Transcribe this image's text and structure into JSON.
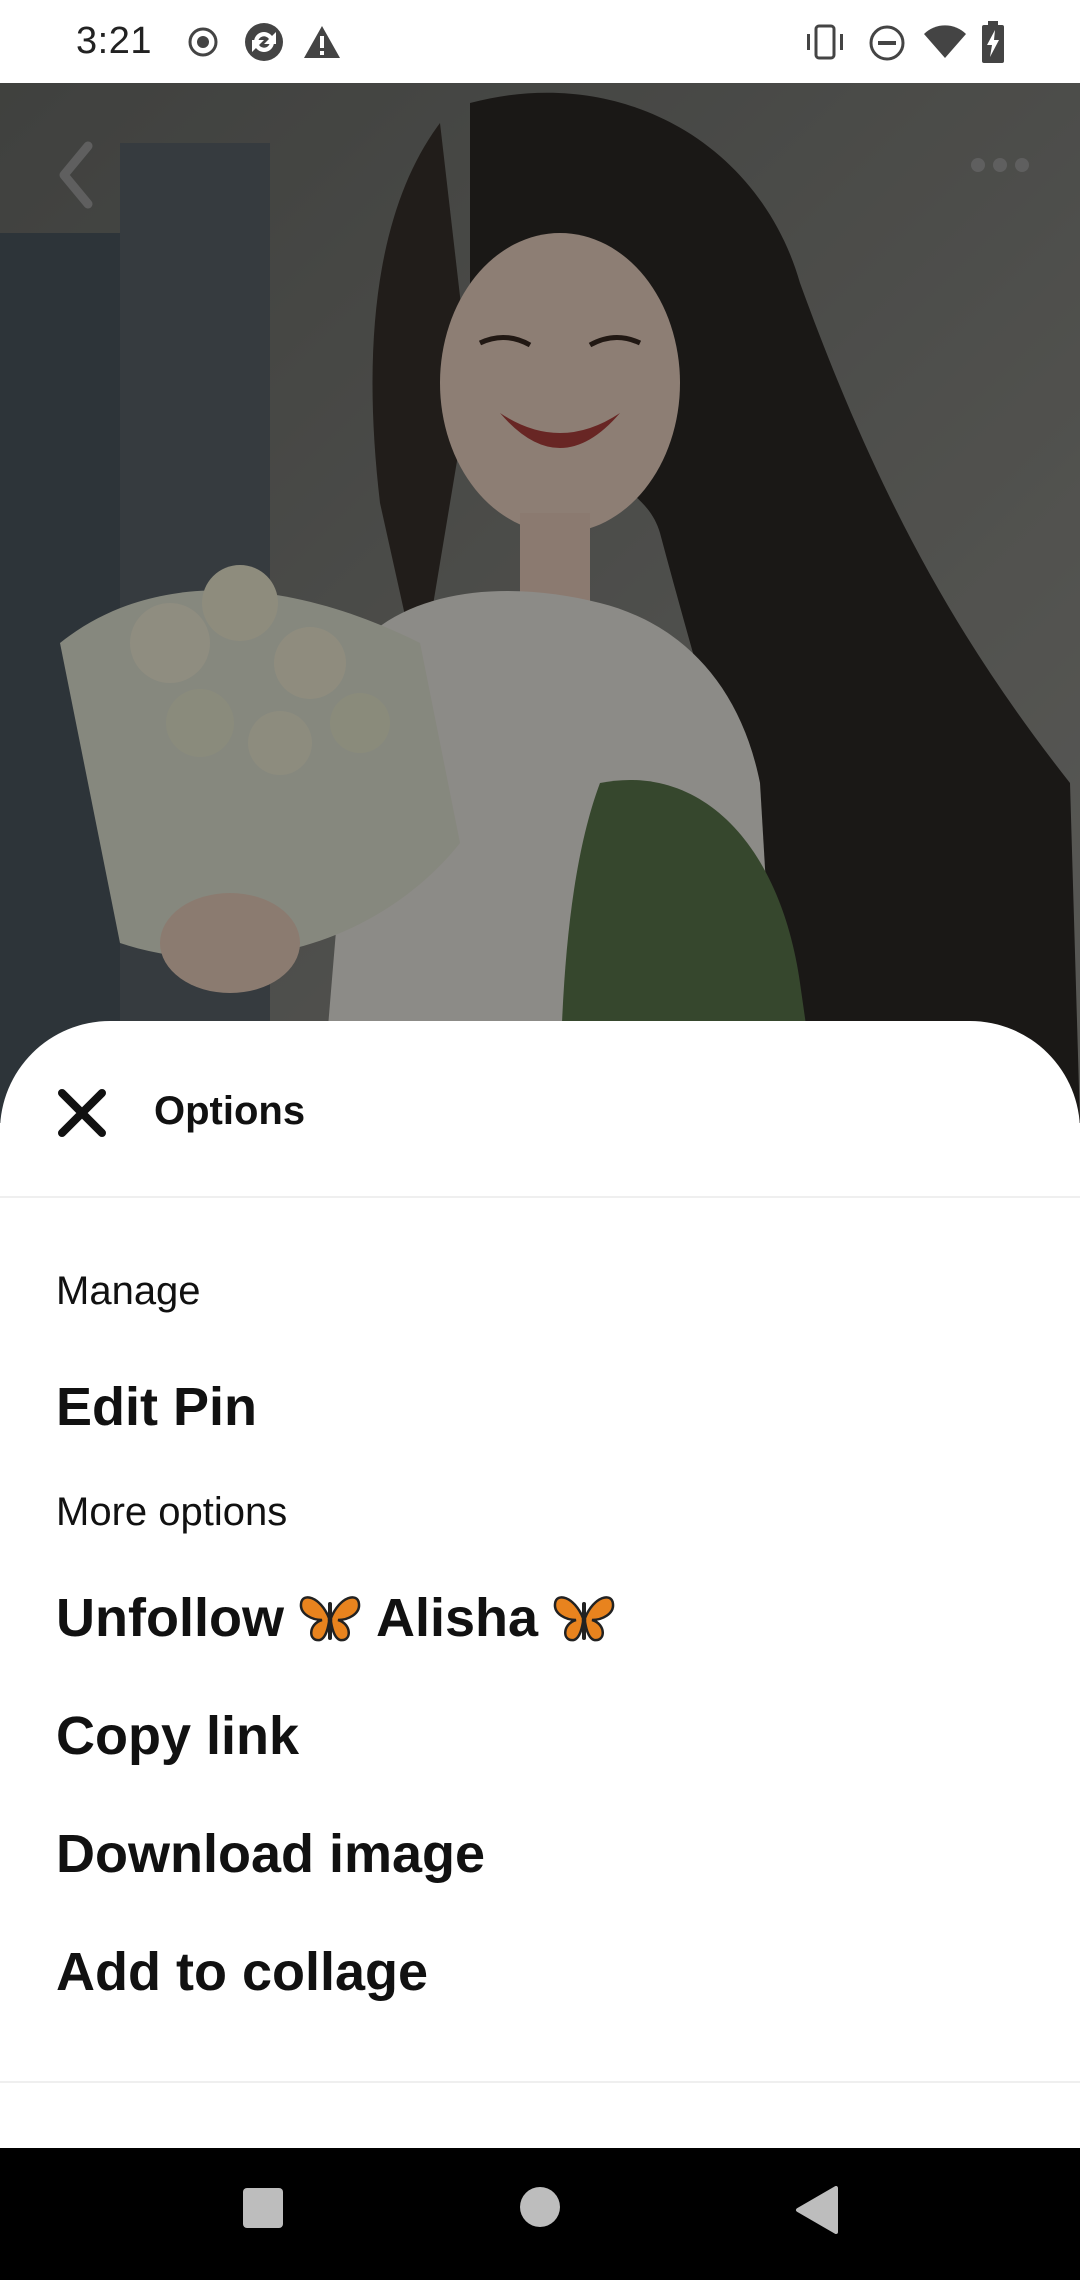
{
  "status_bar": {
    "time": "3:21",
    "left_icons": [
      "record-icon",
      "sync-icon",
      "warning-icon"
    ],
    "right_icons": [
      "vibrate-icon",
      "do-not-disturb-icon",
      "wifi-icon",
      "battery-charging-icon"
    ]
  },
  "pin_view": {
    "image_description_icon": "anime-girl-bouquet-image",
    "top_left_icon": "back-chevron-icon",
    "top_right_icon": "more-options-icon"
  },
  "sheet": {
    "title": "Options",
    "close_icon": "close-icon",
    "sections": [
      {
        "label": "Manage",
        "items": [
          "Edit Pin"
        ]
      },
      {
        "label": "More options",
        "items": [
          "Unfollow 🦋 Alisha 🦋",
          "Copy link",
          "Download image",
          "Add to collage"
        ]
      }
    ],
    "unfollow": {
      "prefix": "Unfollow",
      "name": "Alisha"
    }
  },
  "nav_bar": {
    "buttons": [
      "recents-button",
      "home-button",
      "back-button"
    ]
  },
  "colors": {
    "sheet_bg": "#ffffff",
    "text": "#111111",
    "nav_bg": "#000000",
    "butterfly_orange": "#e8831e"
  }
}
